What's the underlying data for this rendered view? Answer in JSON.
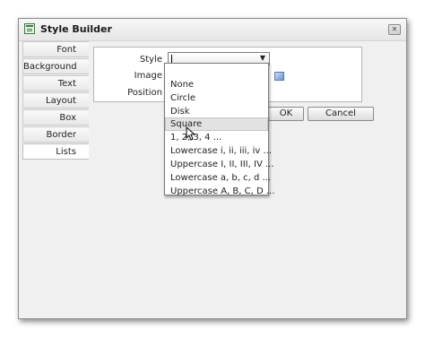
{
  "window": {
    "title": "Style Builder",
    "close_glyph": "✕"
  },
  "tabs": [
    {
      "label": "Font"
    },
    {
      "label": "Background"
    },
    {
      "label": "Text"
    },
    {
      "label": "Layout"
    },
    {
      "label": "Box"
    },
    {
      "label": "Border"
    },
    {
      "label": "Lists",
      "active": true
    }
  ],
  "form": {
    "style_label": "Style",
    "style_value": "",
    "image_label": "Image",
    "position_label": "Position"
  },
  "buttons": {
    "ok_label": "OK",
    "cancel_label": "Cancel"
  },
  "dropdown": {
    "options": [
      "",
      "None",
      "Circle",
      "Disk",
      "Square",
      "1, 2, 3, 4 ...",
      "Lowercase i, ii, iii, iv ...",
      "Uppercase I, II, III, IV ...",
      "Lowercase a, b, c, d ...",
      "Uppercase A, B, C, D ..."
    ],
    "hovered_option": "Square"
  },
  "icons": {
    "app": "style-builder-icon",
    "image_picker": "image-picker-icon",
    "cursor": "mouse-pointer-icon"
  },
  "colors": {
    "window_bg": "#f0f0f0",
    "hover_bg": "#e2e2e2"
  }
}
